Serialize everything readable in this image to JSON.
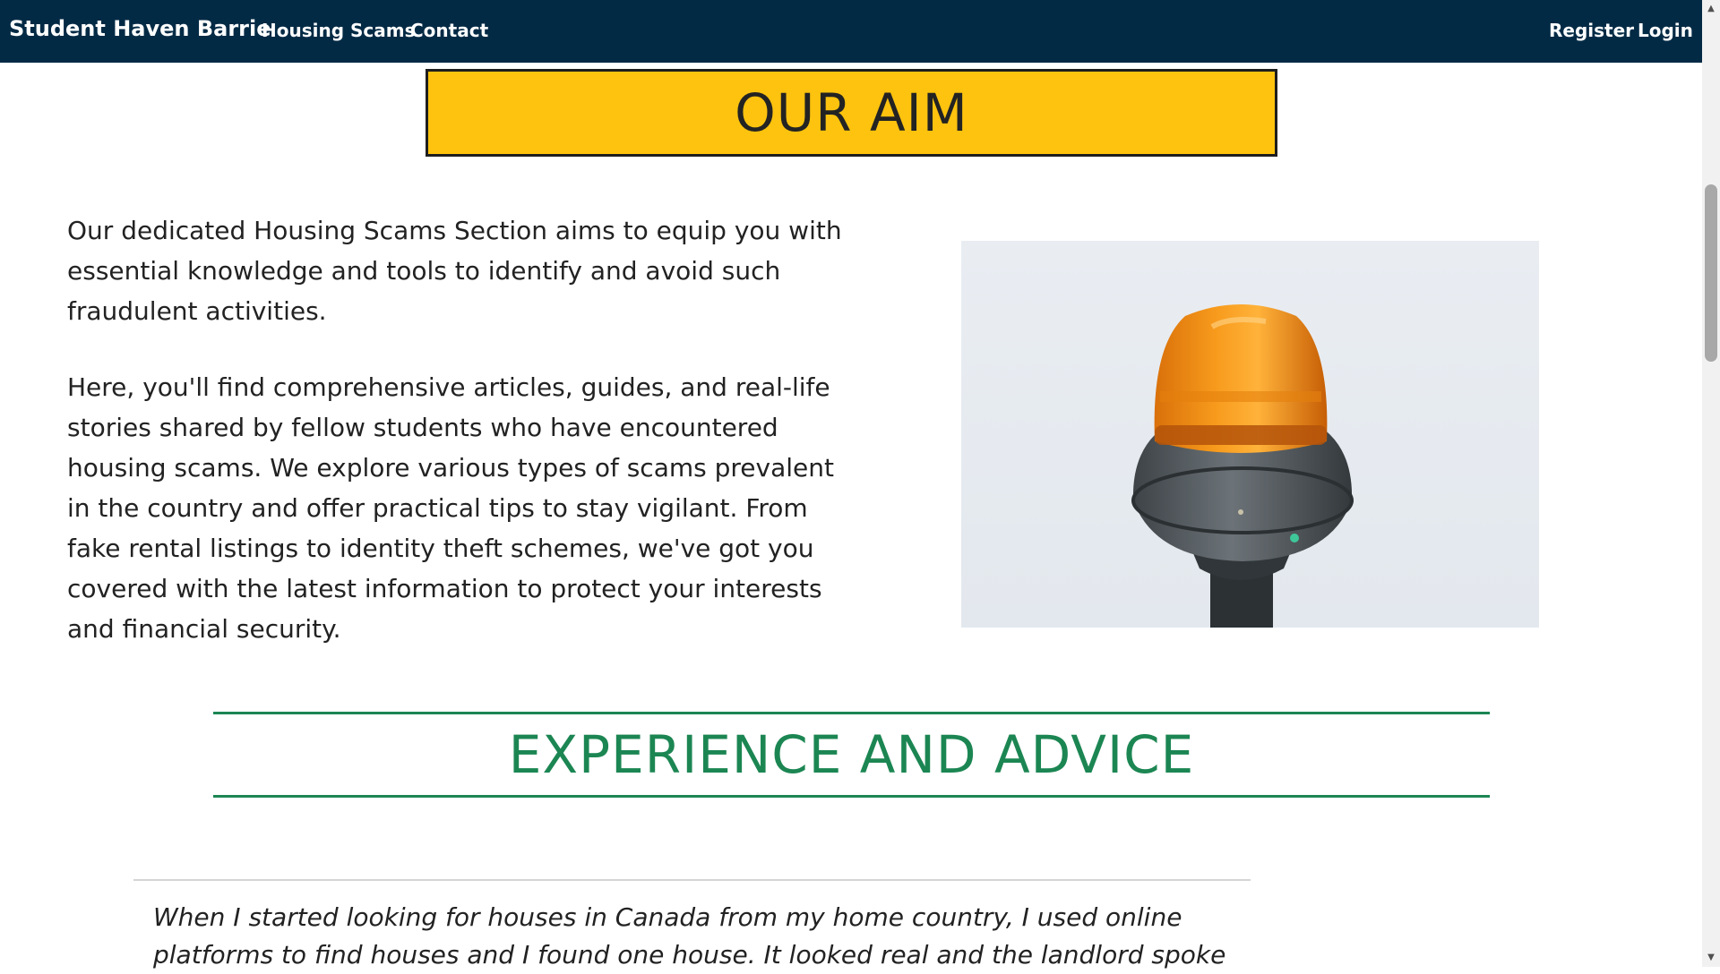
{
  "navbar": {
    "brand": "Student Haven Barrie",
    "links": [
      "Housing Scams",
      "Contact"
    ],
    "right_links": [
      "Register",
      "Login"
    ],
    "background": "#032a45"
  },
  "aim": {
    "title": "OUR AIM",
    "banner_color": "#fec30e",
    "paragraphs": [
      "Our dedicated Housing Scams Section aims to equip you with essential knowledge and tools to identify and avoid such fraudulent activities.",
      "Here, you'll find comprehensive articles, guides, and real-life stories shared by fellow students who have encountered housing scams. We explore various types of scams prevalent in the country and offer practical tips to stay vigilant. From fake rental listings to identity theft schemes, we've got you covered with the latest information to protect your interests and financial security."
    ],
    "image_icon": "warning-beacon-icon"
  },
  "experience": {
    "title": "EXPERIENCE AND ADVICE",
    "accent_color": "#1c8653",
    "quote": "When I started looking for houses in Canada from my home country, I used online platforms to find houses and I found one house. It looked real and the landlord spoke"
  }
}
